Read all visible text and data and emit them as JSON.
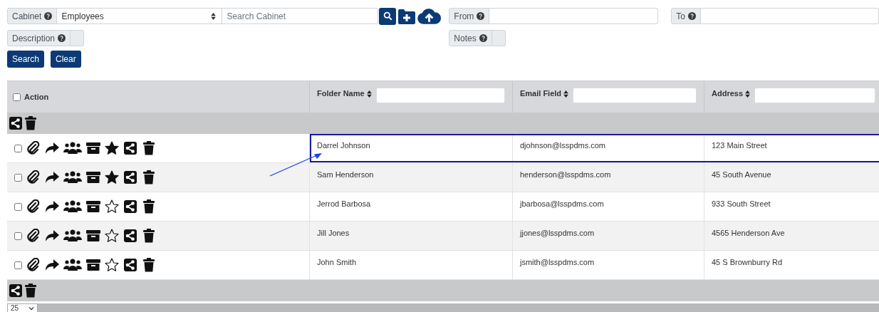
{
  "filters": {
    "cabinet": {
      "label": "Cabinet",
      "value": "Employees"
    },
    "search": {
      "placeholder": "Search Cabinet"
    },
    "from": {
      "label": "From"
    },
    "to": {
      "label": "To"
    },
    "description": {
      "label": "Description"
    },
    "notes": {
      "label": "Notes"
    }
  },
  "buttons": [
    "Search",
    "Clear"
  ],
  "table": {
    "action_header": "Action",
    "select_all_checked": false,
    "columns": [
      {
        "label": "Folder Name"
      },
      {
        "label": "Email Field"
      },
      {
        "label": "Address"
      }
    ],
    "rows": [
      {
        "checked": false,
        "favorite": true,
        "highlighted": true,
        "cells": [
          "Darrel Johnson",
          "djohnson@lsspdms.com",
          "123 Main Street"
        ]
      },
      {
        "checked": false,
        "favorite": true,
        "highlighted": false,
        "cells": [
          "Sam Henderson",
          "henderson@lsspdms.com",
          "45 South Avenue"
        ]
      },
      {
        "checked": false,
        "favorite": false,
        "highlighted": false,
        "cells": [
          "Jerrod Barbosa",
          "jbarbosa@lsspdms.com",
          "933 South Street"
        ]
      },
      {
        "checked": false,
        "favorite": false,
        "highlighted": false,
        "cells": [
          "Jill Jones",
          "jjones@lsspdms.com",
          "4565 Henderson Ave"
        ]
      },
      {
        "checked": false,
        "favorite": false,
        "highlighted": false,
        "cells": [
          "John Smith",
          "jsmith@lsspdms.com",
          "45 S Brownburry Rd"
        ]
      }
    ]
  },
  "pager": {
    "page_size": "25"
  }
}
